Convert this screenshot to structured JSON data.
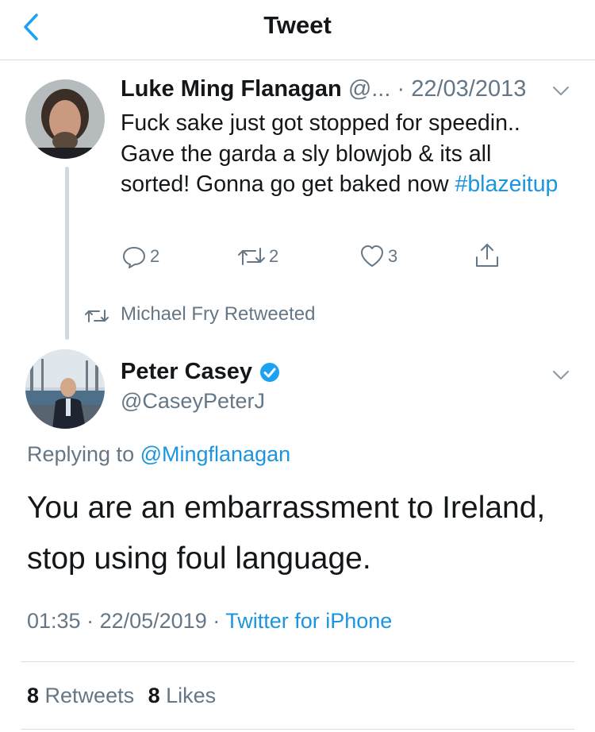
{
  "header": {
    "title": "Tweet"
  },
  "quoted_tweet": {
    "name": "Luke Ming Flanagan",
    "handle_truncated": "@...",
    "date_sep": " · ",
    "date": "22/03/2013",
    "text": "Fuck sake just got stopped for speedin.. Gave the garda a sly blowjob & its all sorted! Gonna go get baked now ",
    "hashtag": "#blazeitup",
    "actions": {
      "replies": "2",
      "retweets": "2",
      "likes": "3"
    }
  },
  "retweet_label": "Michael Fry Retweeted",
  "main_tweet": {
    "name": "Peter Casey",
    "handle": "@CaseyPeterJ",
    "replying_prefix": "Replying to ",
    "replying_to": "@Mingflanagan",
    "text": "You are an embarrassment to Ireland, stop using foul language.",
    "time": "01:35",
    "date_sep": " · ",
    "date": "22/05/2019",
    "source_sep": " · ",
    "source": "Twitter for iPhone",
    "retweets_count": "8",
    "retweets_label": " Retweets",
    "likes_count": "8",
    "likes_label": " Likes"
  },
  "colors": {
    "link": "#1b95e0",
    "muted": "#657786",
    "text": "#14171a",
    "verified": "#1da1f2"
  }
}
